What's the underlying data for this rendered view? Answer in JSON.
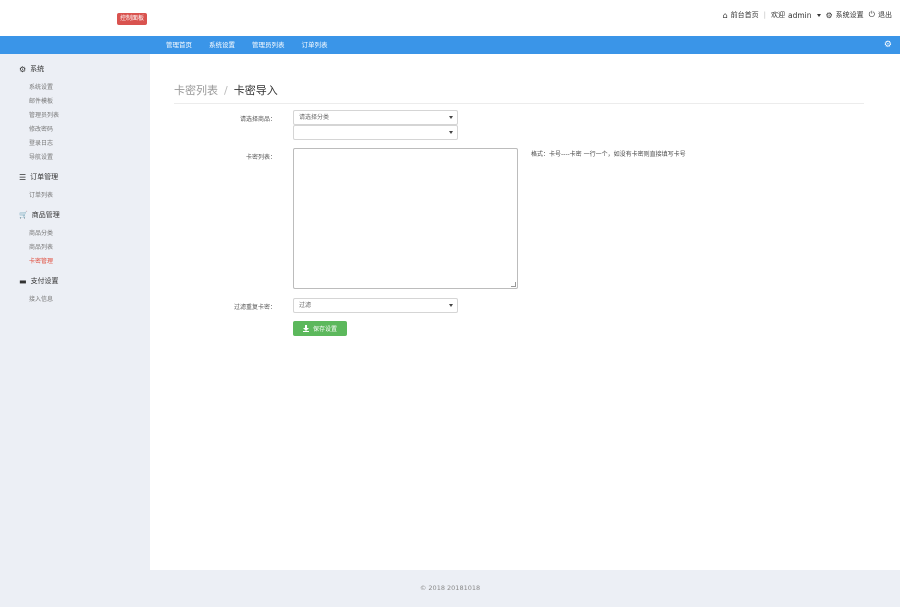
{
  "header": {
    "logo_badge": "控制面板",
    "links": {
      "home": "前台首页",
      "separator": "|",
      "welcome_prefix": "欢迎",
      "username": "admin",
      "settings": "系统设置",
      "logout": "退出"
    }
  },
  "navbar": {
    "items": [
      "管理首页",
      "系统设置",
      "管理员列表",
      "订单列表"
    ],
    "gear_icon": "⚙"
  },
  "sidebar": {
    "sections": [
      {
        "icon": "gear-icon",
        "glyph": "⚙",
        "title": "系统",
        "items": [
          "系统设置",
          "邮件模板",
          "管理员列表",
          "修改密码",
          "登录日志",
          "导航设置"
        ]
      },
      {
        "icon": "list-icon",
        "glyph": "☰",
        "title": "订单管理",
        "items": [
          "订单列表"
        ]
      },
      {
        "icon": "cart-icon",
        "glyph": "🛒",
        "title": "商品管理",
        "items": [
          "商品分类",
          "商品列表",
          "卡密管理"
        ]
      },
      {
        "icon": "card-icon",
        "glyph": "▬",
        "title": "支付设置",
        "items": [
          "接入信息"
        ]
      }
    ],
    "active_item": "卡密管理"
  },
  "main": {
    "breadcrumb": {
      "parent": "卡密列表",
      "separator": "/",
      "current": "卡密导入"
    },
    "form": {
      "product_label": "请选择商品：",
      "category_select_value": "请选择分类",
      "product_select_value": "",
      "cards_label": "卡密列表：",
      "cards_value": "",
      "cards_hint": "格式：卡号----卡密 一行一个，如没有卡密则直接填写卡号",
      "dedupe_label": "过滤重复卡密：",
      "dedupe_value": "过滤",
      "save_label": "保存设置"
    }
  },
  "footer": {
    "copyright": "© 2018 20181018"
  }
}
